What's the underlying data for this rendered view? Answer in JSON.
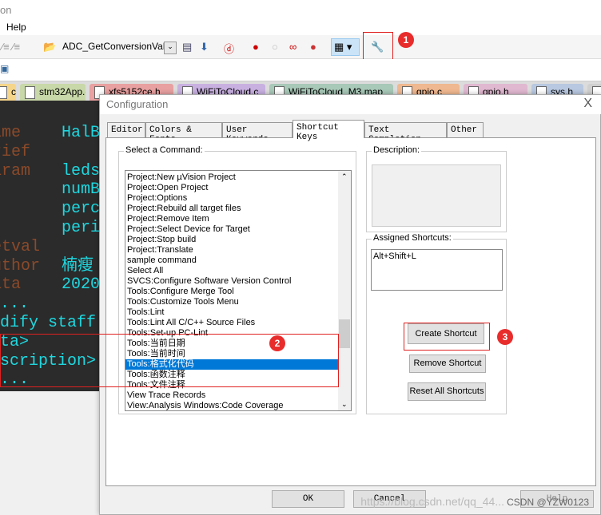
{
  "window": {
    "title_fragment": "on"
  },
  "menu": {
    "help": "Help"
  },
  "toolbar": {
    "target_combo": "ADC_GetConversionValue"
  },
  "file_tabs": [
    "c",
    "stm32App.c",
    "xfs5152ce.h",
    "WiFiToCloud.c",
    "WiFiToCloud_M3.map",
    "gpio.c",
    "gpio.h",
    "sys.h",
    "h"
  ],
  "file_tab_colors": [
    "#f5d58a",
    "#c8d8a8",
    "#e8a0a0",
    "#c8b0e0",
    "#a8c8b8",
    "#f0b890",
    "#e0b8d0",
    "#b8c8e0",
    "#d0d0d0"
  ],
  "editor": {
    "lines": [
      {
        "k": "ame",
        "v": "HalB"
      },
      {
        "k": "rief",
        "v": ""
      },
      {
        "k": "aram",
        "v": "leds"
      },
      {
        "k": "",
        "v": "numB"
      },
      {
        "k": "",
        "v": "perc"
      },
      {
        "k": "",
        "v": "peri"
      },
      {
        "k": "etval",
        "v": ""
      },
      {
        "k": "uthor",
        "v": "楠瘦"
      },
      {
        "k": "ata",
        "v": "2020"
      },
      {
        "k": "",
        "v": " ..."
      },
      {
        "k": "",
        "v": "odify staff"
      },
      {
        "k": "",
        "v": "ata>"
      },
      {
        "k": "",
        "v": "escription>"
      },
      {
        "k": "",
        "v": " ..."
      }
    ]
  },
  "dialog": {
    "title": "Configuration",
    "close": "X",
    "tabs": [
      "Editor",
      "Colors & Fonts",
      "User Keywords",
      "Shortcut Keys",
      "Text Completion",
      "Other"
    ],
    "active_tab": "Shortcut Keys",
    "select_command_label": "Select a Command:",
    "commands": [
      "Project:New µVision Project",
      "Project:Open Project",
      "Project:Options",
      "Project:Rebuild all target files",
      "Project:Remove Item",
      "Project:Select Device for Target",
      "Project:Stop build",
      "Project:Translate",
      "sample command",
      "Select All",
      "SVCS:Configure Software Version Control",
      "Tools:Configure Merge Tool",
      "Tools:Customize Tools Menu",
      "Tools:Lint",
      "Tools:Lint All C/C++ Source Files",
      "Tools:Set-up PC-Lint",
      "Tools:当前日期",
      "Tools:当前时间",
      "Tools:格式化代码",
      "Tools:函数注释",
      "Tools:文件注释",
      "View Trace Records",
      "View:Analysis Windows:Code Coverage"
    ],
    "selected_command": "Tools:格式化代码",
    "description_label": "Description:",
    "assigned_label": "Assigned Shortcuts:",
    "assigned": [
      "Alt+Shift+L"
    ],
    "create": "Create Shortcut",
    "remove": "Remove Shortcut",
    "reset": "Reset All Shortcuts",
    "ok": "OK",
    "cancel": "Cancel",
    "help": "Help"
  },
  "annotations": [
    "1",
    "2",
    "3"
  ],
  "watermark": "https://blog.csdn.net/qq_44...",
  "watermark2": "CSDN @YZW0123",
  "colors": {
    "selection": "#0078d7",
    "annotation": "#e82c2c",
    "editor_bg": "#2b2b2b"
  }
}
